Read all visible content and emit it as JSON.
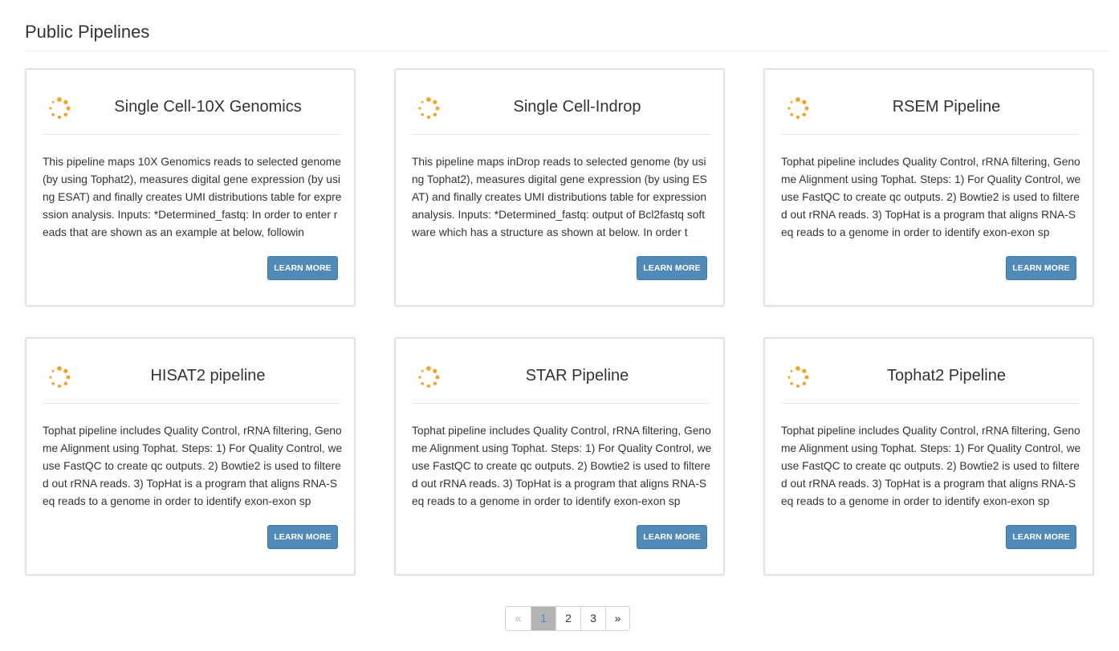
{
  "page": {
    "title": "Public Pipelines"
  },
  "colors": {
    "accent_button": "#4f8ab9",
    "spinner_dot": "#f5a22a",
    "active_page_bg": "#b3b3b3"
  },
  "cards": [
    {
      "icon": "spinner-icon",
      "title": "Single Cell-10X Genomics",
      "description": "This pipeline maps 10X Genomics reads to selected genome (by using Tophat2), measures digital gene expression (by using ESAT) and finally creates UMI distributions table for expression analysis. Inputs: *Determined_fastq: In order to enter reads that are shown as an example at below, followin",
      "button": "LEARN MORE"
    },
    {
      "icon": "spinner-icon",
      "title": "Single Cell-Indrop",
      "description": "This pipeline maps inDrop reads to selected genome (by using Tophat2), measures digital gene expression (by using ESAT) and finally creates UMI distributions table for expression analysis. Inputs: *Determined_fastq: output of Bcl2fastq software which has a structure as shown at below. In order t",
      "button": "LEARN MORE"
    },
    {
      "icon": "spinner-icon",
      "title": "RSEM Pipeline",
      "description": "Tophat pipeline includes Quality Control, rRNA filtering, Genome Alignment using Tophat. Steps: 1) For Quality Control, we use FastQC to create qc outputs. 2) Bowtie2 is used to filtered out rRNA reads. 3) TopHat is a program that aligns RNA-Seq reads to a genome in order to identify exon-exon sp",
      "button": "LEARN MORE"
    },
    {
      "icon": "spinner-icon",
      "title": "HISAT2 pipeline",
      "description": "Tophat pipeline includes Quality Control, rRNA filtering, Genome Alignment using Tophat. Steps: 1) For Quality Control, we use FastQC to create qc outputs. 2) Bowtie2 is used to filtered out rRNA reads. 3) TopHat is a program that aligns RNA-Seq reads to a genome in order to identify exon-exon sp",
      "button": "LEARN MORE"
    },
    {
      "icon": "spinner-icon",
      "title": "STAR Pipeline",
      "description": "Tophat pipeline includes Quality Control, rRNA filtering, Genome Alignment using Tophat. Steps: 1) For Quality Control, we use FastQC to create qc outputs. 2) Bowtie2 is used to filtered out rRNA reads. 3) TopHat is a program that aligns RNA-Seq reads to a genome in order to identify exon-exon sp",
      "button": "LEARN MORE"
    },
    {
      "icon": "spinner-icon",
      "title": "Tophat2 Pipeline",
      "description": "Tophat pipeline includes Quality Control, rRNA filtering, Genome Alignment using Tophat. Steps: 1) For Quality Control, we use FastQC to create qc outputs. 2) Bowtie2 is used to filtered out rRNA reads. 3) TopHat is a program that aligns RNA-Seq reads to a genome in order to identify exon-exon sp",
      "button": "LEARN MORE"
    }
  ],
  "pagination": {
    "prev": "«",
    "pages": [
      "1",
      "2",
      "3"
    ],
    "current": "1",
    "next": "»"
  }
}
